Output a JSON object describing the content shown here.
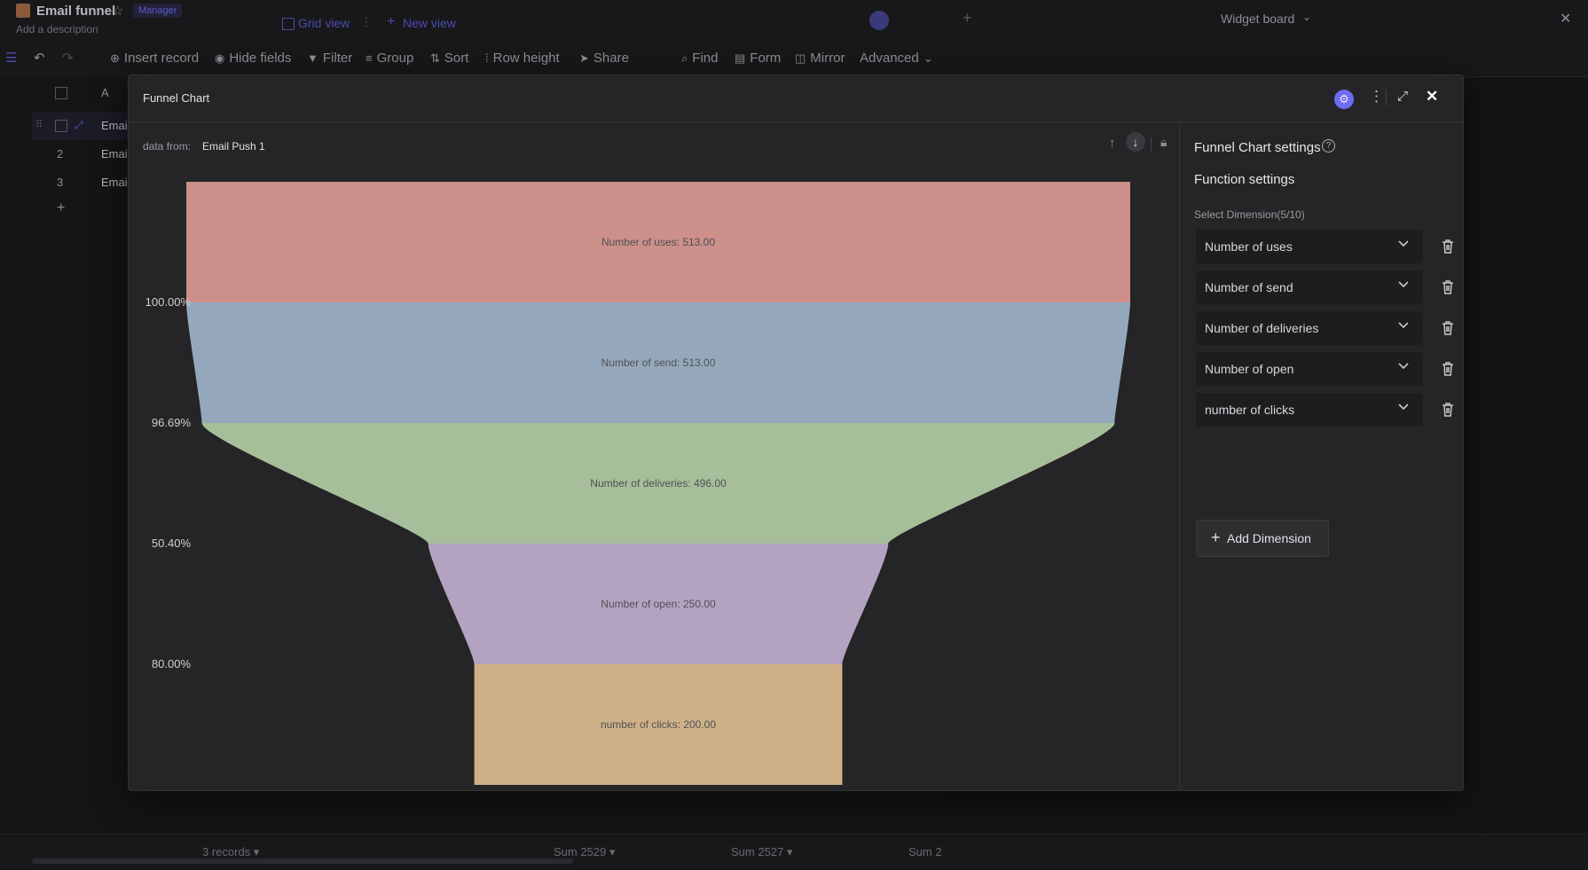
{
  "app": {
    "title": "Email funnel",
    "role_badge": "Manager",
    "description": "Add a description",
    "views": [
      {
        "label": "Grid view",
        "active": true
      },
      {
        "label": "New view",
        "active": false
      }
    ],
    "widget_board": "Widget board"
  },
  "toolbar": {
    "items": [
      "Insert record",
      "Hide fields",
      "Filter",
      "Group",
      "Sort",
      "Row height",
      "Share",
      "Find",
      "Form",
      "Mirror",
      "Advanced"
    ]
  },
  "grid": {
    "header": "A",
    "rows": [
      {
        "num": "",
        "label": "Emai"
      },
      {
        "num": "2",
        "label": "Emai"
      },
      {
        "num": "3",
        "label": "Emai"
      }
    ],
    "add": "+"
  },
  "footer": {
    "records": "3 records ▾",
    "sums": [
      "Sum 2529 ▾",
      "Sum 2527 ▾",
      "Sum 2"
    ]
  },
  "modal": {
    "title": "Funnel Chart",
    "data_from_label": "data from:",
    "data_from_value": "Email Push 1"
  },
  "settings": {
    "title": "Funnel Chart settings",
    "section": "Function settings",
    "select_label": "Select Dimension(5/10)",
    "dimensions": [
      "Number of uses",
      "Number of send",
      "Number of deliveries",
      "Number of open",
      "number of clicks"
    ],
    "add_button": "Add Dimension"
  },
  "colors": {
    "accent": "#6e6cf0",
    "stages": [
      "#cc8f8a",
      "#95a8bb",
      "#a6bf9a",
      "#b3a3c0",
      "#cfb187"
    ]
  },
  "chart_data": {
    "type": "funnel",
    "categories": [
      "Number of uses",
      "Number of send",
      "Number of deliveries",
      "Number of open",
      "number of clicks"
    ],
    "values": [
      513,
      513,
      496,
      250,
      200
    ],
    "labels": [
      "Number of uses: 513.00",
      "Number of send: 513.00",
      "Number of deliveries: 496.00",
      "Number of open: 250.00",
      "number of clicks: 200.00"
    ],
    "conversion_labels": [
      "100.00%",
      "96.69%",
      "50.40%",
      "80.00%"
    ]
  }
}
